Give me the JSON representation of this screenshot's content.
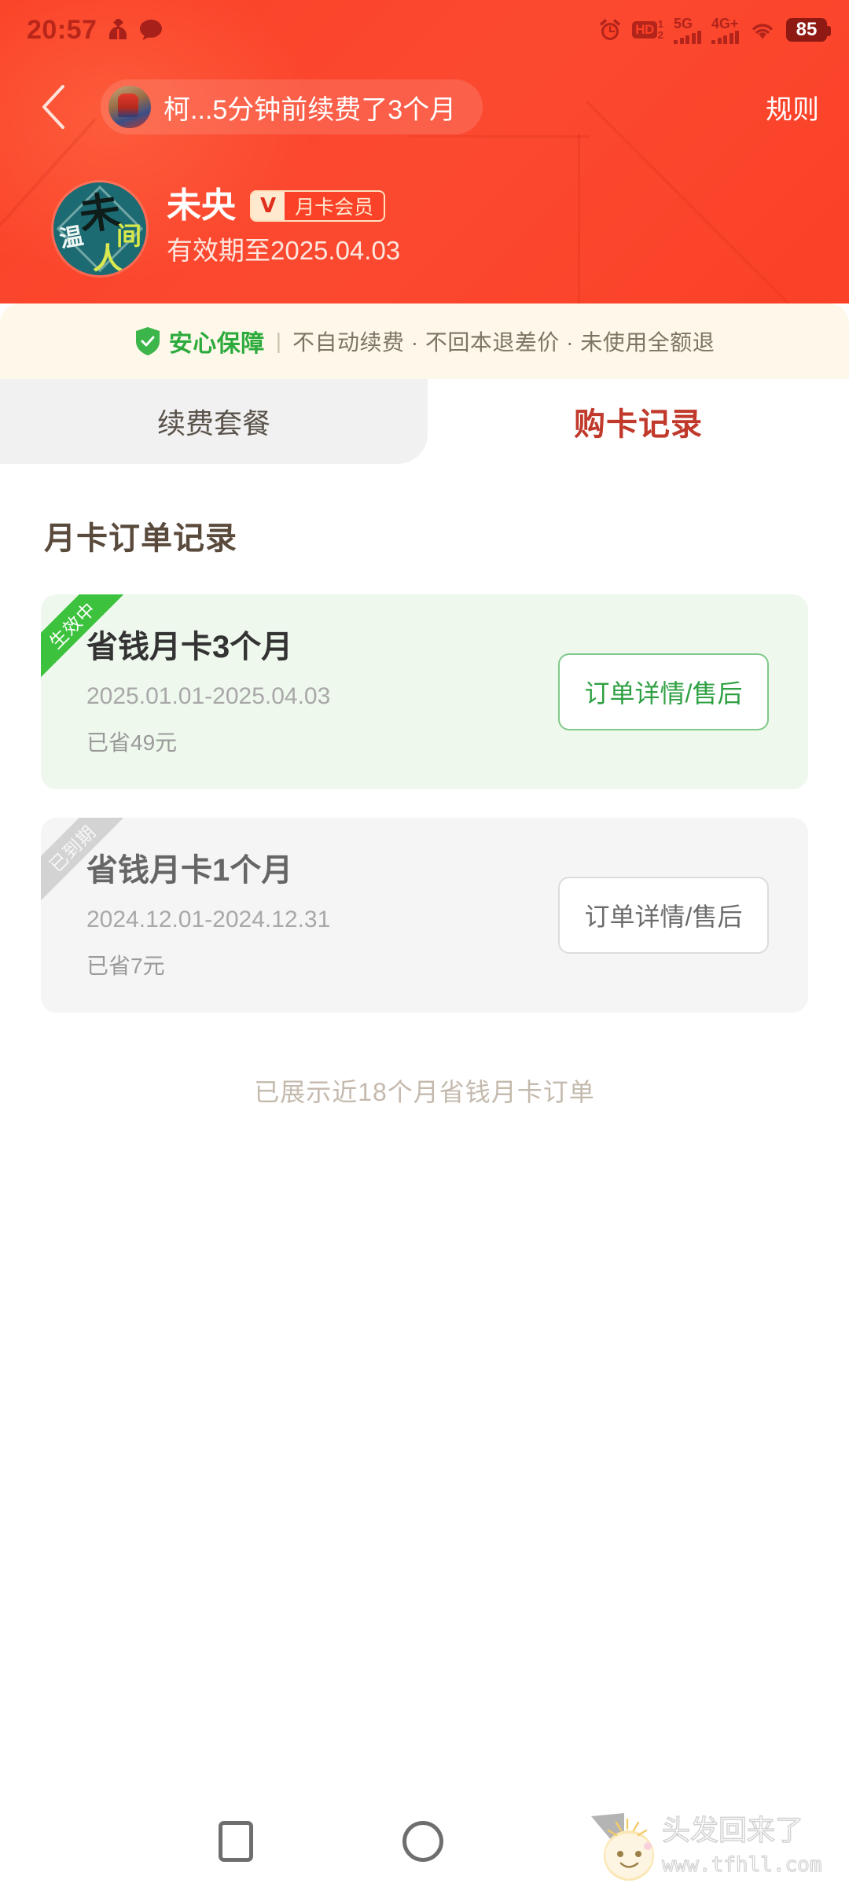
{
  "status_bar": {
    "time": "20:57",
    "icons_left": [
      "contact-notification-icon",
      "message-bubble-icon"
    ],
    "icons_right": [
      "alarm-icon",
      "hd-dual-sim-icon",
      "signal-5g-icon",
      "signal-4g-plus-icon",
      "wifi-icon",
      "battery-icon"
    ],
    "hd_label": "HD",
    "hd_sim1": "1",
    "hd_sim2": "2",
    "net1_label": "5G",
    "net2_label": "4G+",
    "battery_level": "85"
  },
  "header": {
    "back_icon": "chevron-left-icon",
    "marquee": {
      "avatar_icon": "user-avatar-icon",
      "text": "柯...5分钟前续费了3个月"
    },
    "rules_label": "规则",
    "background_color": "#fb4127"
  },
  "profile": {
    "avatar_icon": "profile-avatar-icon",
    "avatar_chars": {
      "main": "未",
      "left": "温",
      "right": "间",
      "bottom": "人"
    },
    "username": "未央",
    "vip_badge": {
      "mark": "V",
      "label": "月卡会员"
    },
    "expire_text": "有效期至2025.04.03"
  },
  "guarantee": {
    "shield_icon": "shield-check-icon",
    "strong": "安心保障",
    "separator": "|",
    "rest": "不自动续费 · 不回本退差价 · 未使用全额退",
    "accent_color": "#2cab3c",
    "background_color": "#fdf8e9"
  },
  "tabs": [
    {
      "label": "续费套餐",
      "active": false
    },
    {
      "label": "购卡记录",
      "active": true
    }
  ],
  "main": {
    "section_title": "月卡订单记录",
    "orders": [
      {
        "ribbon": "生效中",
        "ribbon_state": "active",
        "title": "省钱月卡3个月",
        "dates": "2025.01.01-2025.04.03",
        "saved": "已省49元",
        "button_label": "订单详情/售后"
      },
      {
        "ribbon": "已到期",
        "ribbon_state": "expired",
        "title": "省钱月卡1个月",
        "dates": "2024.12.01-2024.12.31",
        "saved": "已省7元",
        "button_label": "订单详情/售后"
      }
    ],
    "footer_note": "已展示近18个月省钱月卡订单"
  },
  "navbar": {
    "recents_icon": "square-recents-icon",
    "home_icon": "circle-home-icon",
    "watermark": {
      "title": "头发回来了",
      "url": "www.tfhll.com"
    }
  }
}
